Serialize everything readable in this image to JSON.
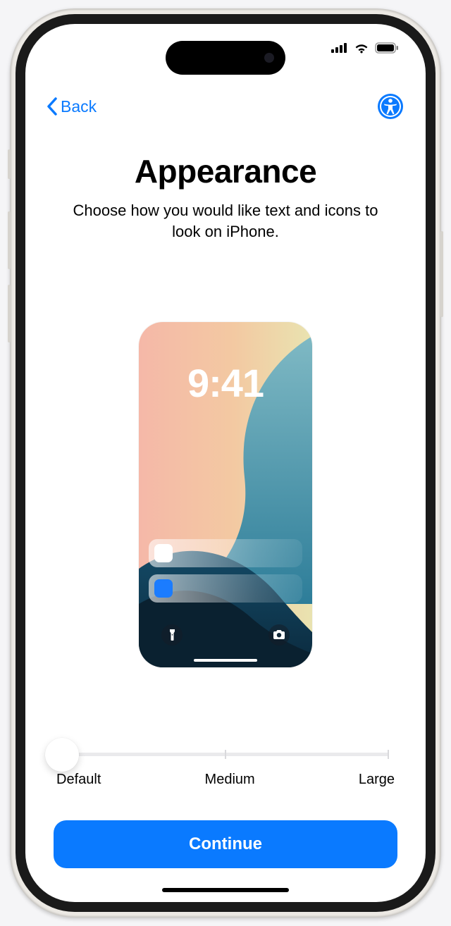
{
  "nav": {
    "back_label": "Back"
  },
  "header": {
    "title": "Appearance",
    "subtitle": "Choose how you would like text and icons to look on iPhone."
  },
  "preview": {
    "time": "9:41"
  },
  "slider": {
    "labels": [
      "Default",
      "Medium",
      "Large"
    ],
    "selected_index": 0
  },
  "cta": {
    "continue_label": "Continue"
  },
  "colors": {
    "accent": "#0a7aff"
  }
}
